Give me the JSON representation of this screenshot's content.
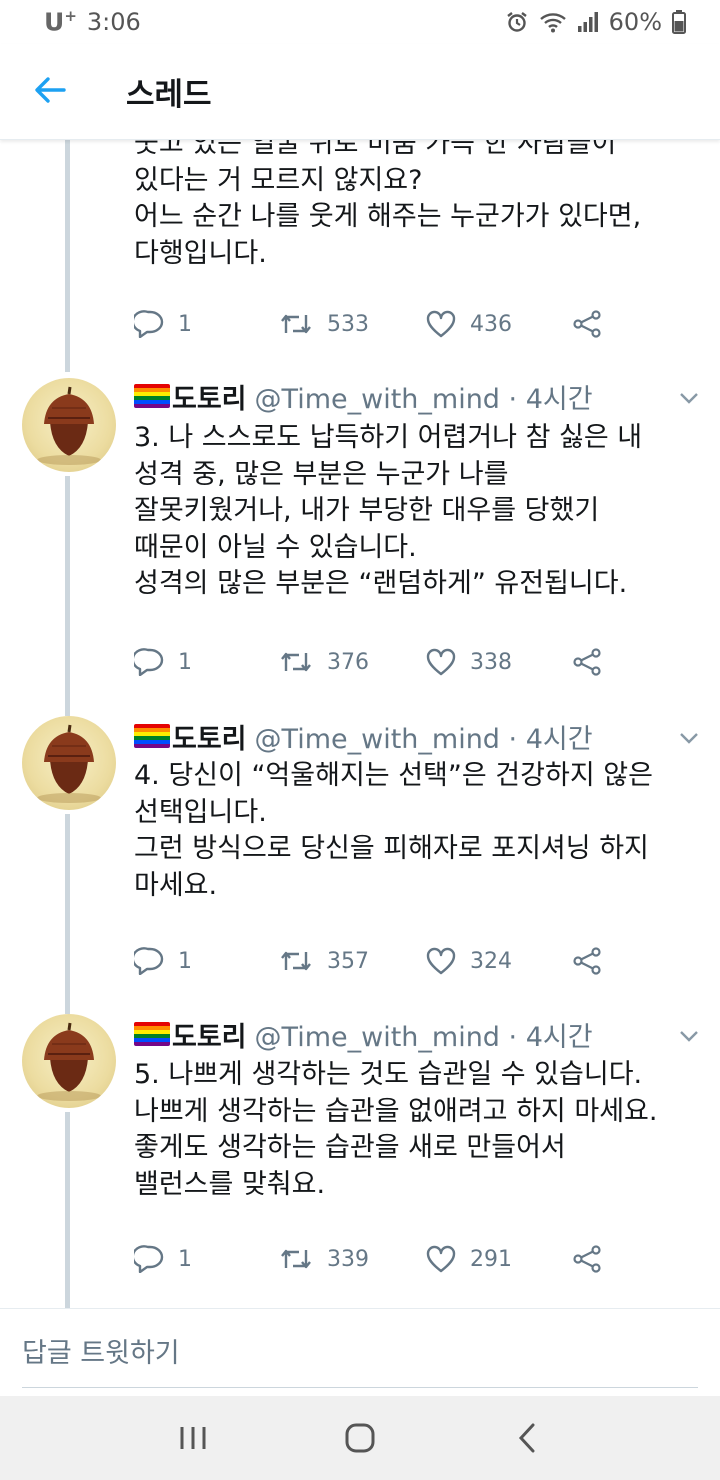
{
  "status_bar": {
    "carrier": "U",
    "carrier_suffix": "+",
    "time": "3:06",
    "battery": "60%"
  },
  "header": {
    "title": "스레드"
  },
  "partial_tweet": {
    "lines": [
      "웃고 있는 얼굴 뒤로 미움 가득 한 사람들이",
      "있다는 거 모르지 않지요?",
      "어느 순간 나를 웃게 해주는 누군가가 있다면,",
      "다행입니다."
    ],
    "replies": "1",
    "retweets": "533",
    "likes": "436"
  },
  "tweets": [
    {
      "name": "도토리",
      "handle": "@Time_with_mind · 4시간",
      "lines": [
        "3. 나 스스로도 납득하기 어렵거나 참 싫은 내",
        "성격 중, 많은 부분은 누군가 나를",
        "잘못키웠거나, 내가 부당한 대우를 당했기",
        "때문이 아닐 수 있습니다.",
        "성격의 많은 부분은 “랜덤하게” 유전됩니다."
      ],
      "replies": "1",
      "retweets": "376",
      "likes": "338"
    },
    {
      "name": "도토리",
      "handle": "@Time_with_mind · 4시간",
      "lines": [
        "4. 당신이 “억울해지는 선택”은 건강하지 않은",
        "선택입니다.",
        "그런 방식으로 당신을 피해자로 포지셔닝 하지",
        "마세요."
      ],
      "replies": "1",
      "retweets": "357",
      "likes": "324"
    },
    {
      "name": "도토리",
      "handle": "@Time_with_mind · 4시간",
      "lines": [
        "5. 나쁘게 생각하는 것도 습관일 수 있습니다.",
        "나쁘게 생각하는 습관을 없애려고 하지 마세요.",
        "좋게도 생각하는 습관을 새로 만들어서",
        "밸런스를 맞춰요."
      ],
      "replies": "1",
      "retweets": "339",
      "likes": "291"
    }
  ],
  "reply_bar": {
    "placeholder": "답글 트윗하기"
  },
  "icons": {
    "back": "arrow-left-icon",
    "reply": "reply-icon",
    "retweet": "retweet-icon",
    "like": "heart-icon",
    "share": "share-icon",
    "caret": "chevron-down-icon",
    "alarm": "alarm-icon",
    "wifi": "wifi-icon",
    "signal": "signal-icon",
    "battery": "battery-icon"
  },
  "colors": {
    "accent": "#1da1f2",
    "text": "#14171a",
    "secondary": "#657786",
    "thread_line": "#ccd6dd"
  }
}
